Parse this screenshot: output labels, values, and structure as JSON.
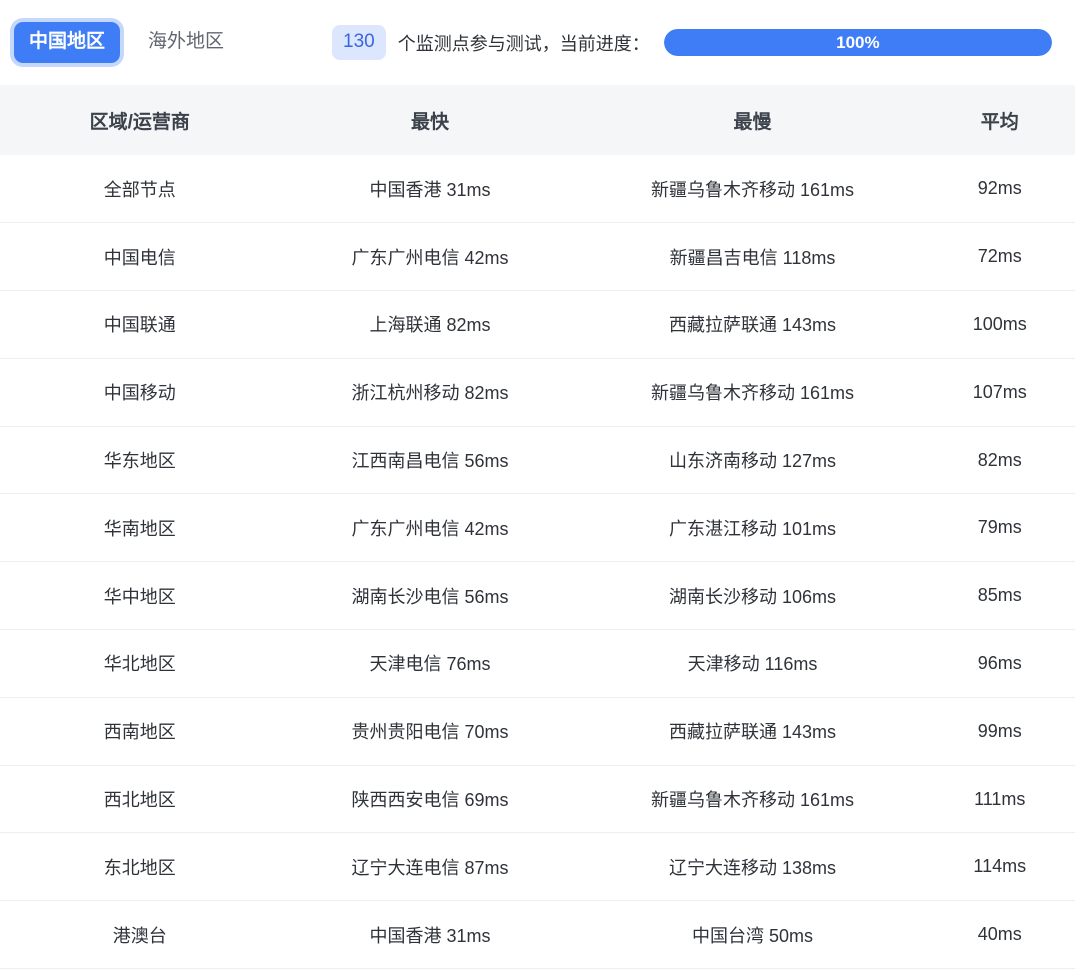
{
  "tabs": [
    {
      "label": "中国地区",
      "active": true
    },
    {
      "label": "海外地区",
      "active": false
    }
  ],
  "monitor": {
    "count": "130",
    "text": "个监测点参与测试，当前进度：",
    "progress_label": "100%",
    "progress_percent": 100
  },
  "colors": {
    "accent": "#3f7df6",
    "badge_bg": "#dce6fc",
    "badge_text": "#3a66e0",
    "header_bg": "#f5f6f7",
    "row_border": "#ebeef5",
    "text": "#2f3339"
  },
  "table": {
    "headers": [
      "区域/运营商",
      "最快",
      "最慢",
      "平均"
    ],
    "rows": [
      [
        "全部节点",
        "中国香港 31ms",
        "新疆乌鲁木齐移动 161ms",
        "92ms"
      ],
      [
        "中国电信",
        "广东广州电信 42ms",
        "新疆昌吉电信 118ms",
        "72ms"
      ],
      [
        "中国联通",
        "上海联通 82ms",
        "西藏拉萨联通 143ms",
        "100ms"
      ],
      [
        "中国移动",
        "浙江杭州移动 82ms",
        "新疆乌鲁木齐移动 161ms",
        "107ms"
      ],
      [
        "华东地区",
        "江西南昌电信 56ms",
        "山东济南移动 127ms",
        "82ms"
      ],
      [
        "华南地区",
        "广东广州电信 42ms",
        "广东湛江移动 101ms",
        "79ms"
      ],
      [
        "华中地区",
        "湖南长沙电信 56ms",
        "湖南长沙移动 106ms",
        "85ms"
      ],
      [
        "华北地区",
        "天津电信 76ms",
        "天津移动 116ms",
        "96ms"
      ],
      [
        "西南地区",
        "贵州贵阳电信 70ms",
        "西藏拉萨联通 143ms",
        "99ms"
      ],
      [
        "西北地区",
        "陕西西安电信 69ms",
        "新疆乌鲁木齐移动 161ms",
        "111ms"
      ],
      [
        "东北地区",
        "辽宁大连电信 87ms",
        "辽宁大连移动 138ms",
        "114ms"
      ],
      [
        "港澳台",
        "中国香港 31ms",
        "中国台湾 50ms",
        "40ms"
      ]
    ]
  }
}
